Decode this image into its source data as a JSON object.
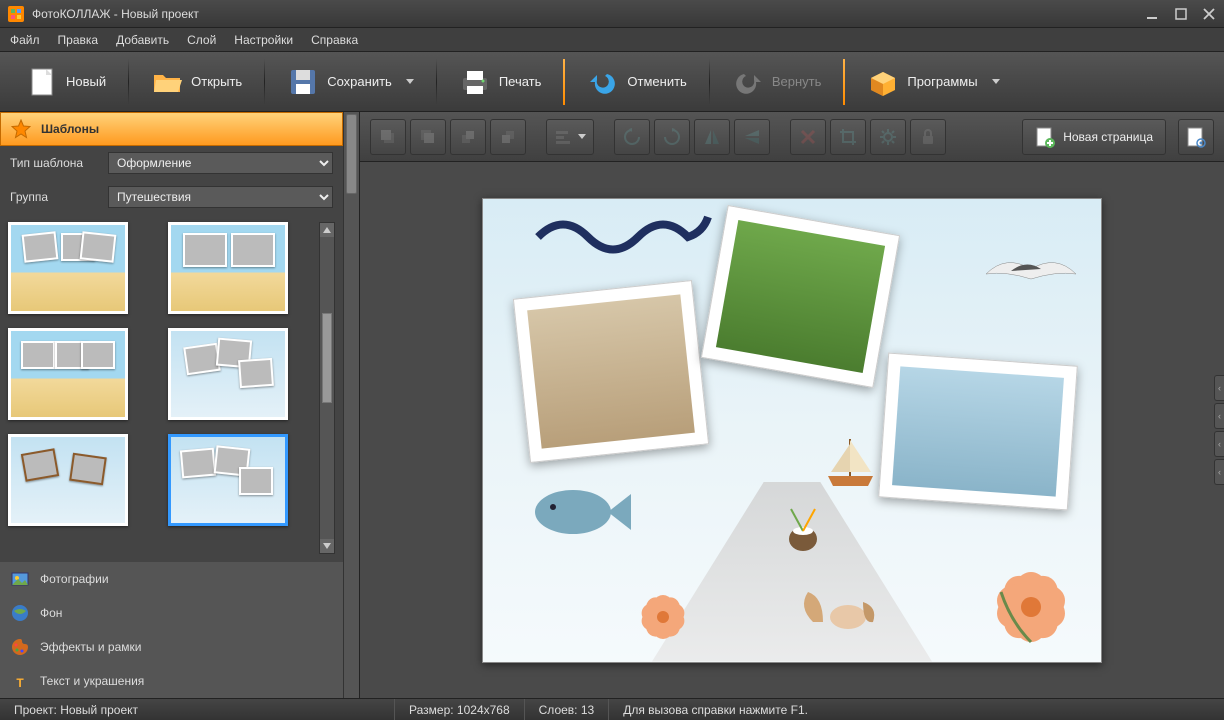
{
  "titlebar": {
    "title": "ФотоКОЛЛАЖ - Новый проект"
  },
  "menu": {
    "items": [
      "Файл",
      "Правка",
      "Добавить",
      "Слой",
      "Настройки",
      "Справка"
    ]
  },
  "toolbar": {
    "new": "Новый",
    "open": "Открыть",
    "save": "Сохранить",
    "print": "Печать",
    "undo": "Отменить",
    "redo": "Вернуть",
    "programs": "Программы"
  },
  "sidebar": {
    "panels": {
      "templates": "Шаблоны",
      "photos": "Фотографии",
      "background": "Фон",
      "effects": "Эффекты и рамки",
      "text": "Текст и украшения"
    },
    "filters": {
      "type_label": "Тип шаблона",
      "type_value": "Оформление",
      "group_label": "Группа",
      "group_value": "Путешествия"
    }
  },
  "canvas_toolbar": {
    "new_page": "Новая страница",
    "tools": {
      "bring_front": "bring-to-front",
      "send_back": "send-to-back",
      "bring_forward": "bring-forward",
      "send_backward": "send-backward",
      "align": "align",
      "flip_h": "flip-horizontal",
      "flip_v": "flip-vertical",
      "mirror_h": "mirror-horizontal",
      "mirror_v": "mirror-vertical",
      "delete": "delete",
      "crop": "crop",
      "gear": "properties",
      "lock": "lock"
    }
  },
  "statusbar": {
    "project_label": "Проект:",
    "project_value": "Новый проект",
    "size_label": "Размер:",
    "size_value": "1024x768",
    "layers_label": "Слоев:",
    "layers_value": "13",
    "help": "Для вызова справки нажмите F1."
  }
}
